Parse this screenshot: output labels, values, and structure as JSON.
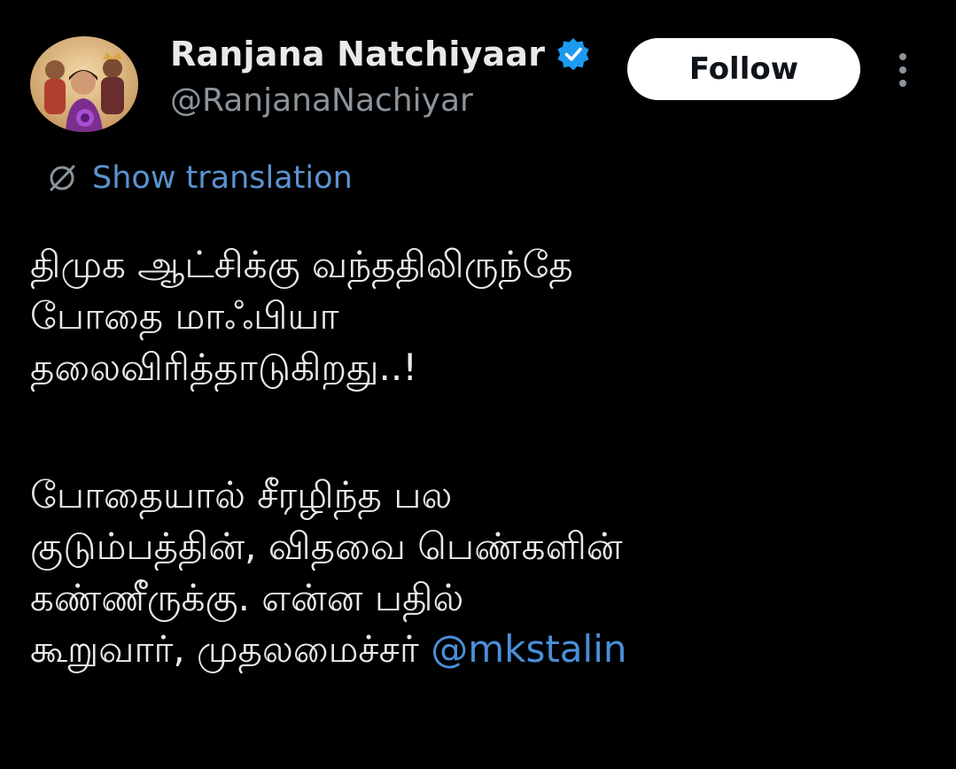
{
  "author": {
    "display_name": "Ranjana Natchiyaar",
    "handle": "@RanjanaNachiyar",
    "verified": true,
    "avatar": "profile-photo"
  },
  "actions": {
    "follow_label": "Follow",
    "more_icon": "more-vertical-icon"
  },
  "translation": {
    "icon": "globe-off-icon",
    "label": "Show translation"
  },
  "tweet": {
    "paragraph1": [
      "திமுக ஆட்சிக்கு வந்ததிலிருந்தே",
      "போதை மாஃபியா",
      "தலைவிரித்தாடுகிறது..!"
    ],
    "paragraph2": [
      "போதையால் சீரழிந்த பல",
      "குடும்பத்தின், விதவை பெண்களின்",
      "கண்ணீருக்கு. என்ன பதில்"
    ],
    "last_line_text": "கூறுவார், முதலமைச்சர் ",
    "mention": "@mkstalin"
  },
  "colors": {
    "background": "#000000",
    "text": "#e7e9ea",
    "secondary": "#8b949a",
    "link": "#4a8fd8",
    "verified": "#1d9bf0"
  }
}
